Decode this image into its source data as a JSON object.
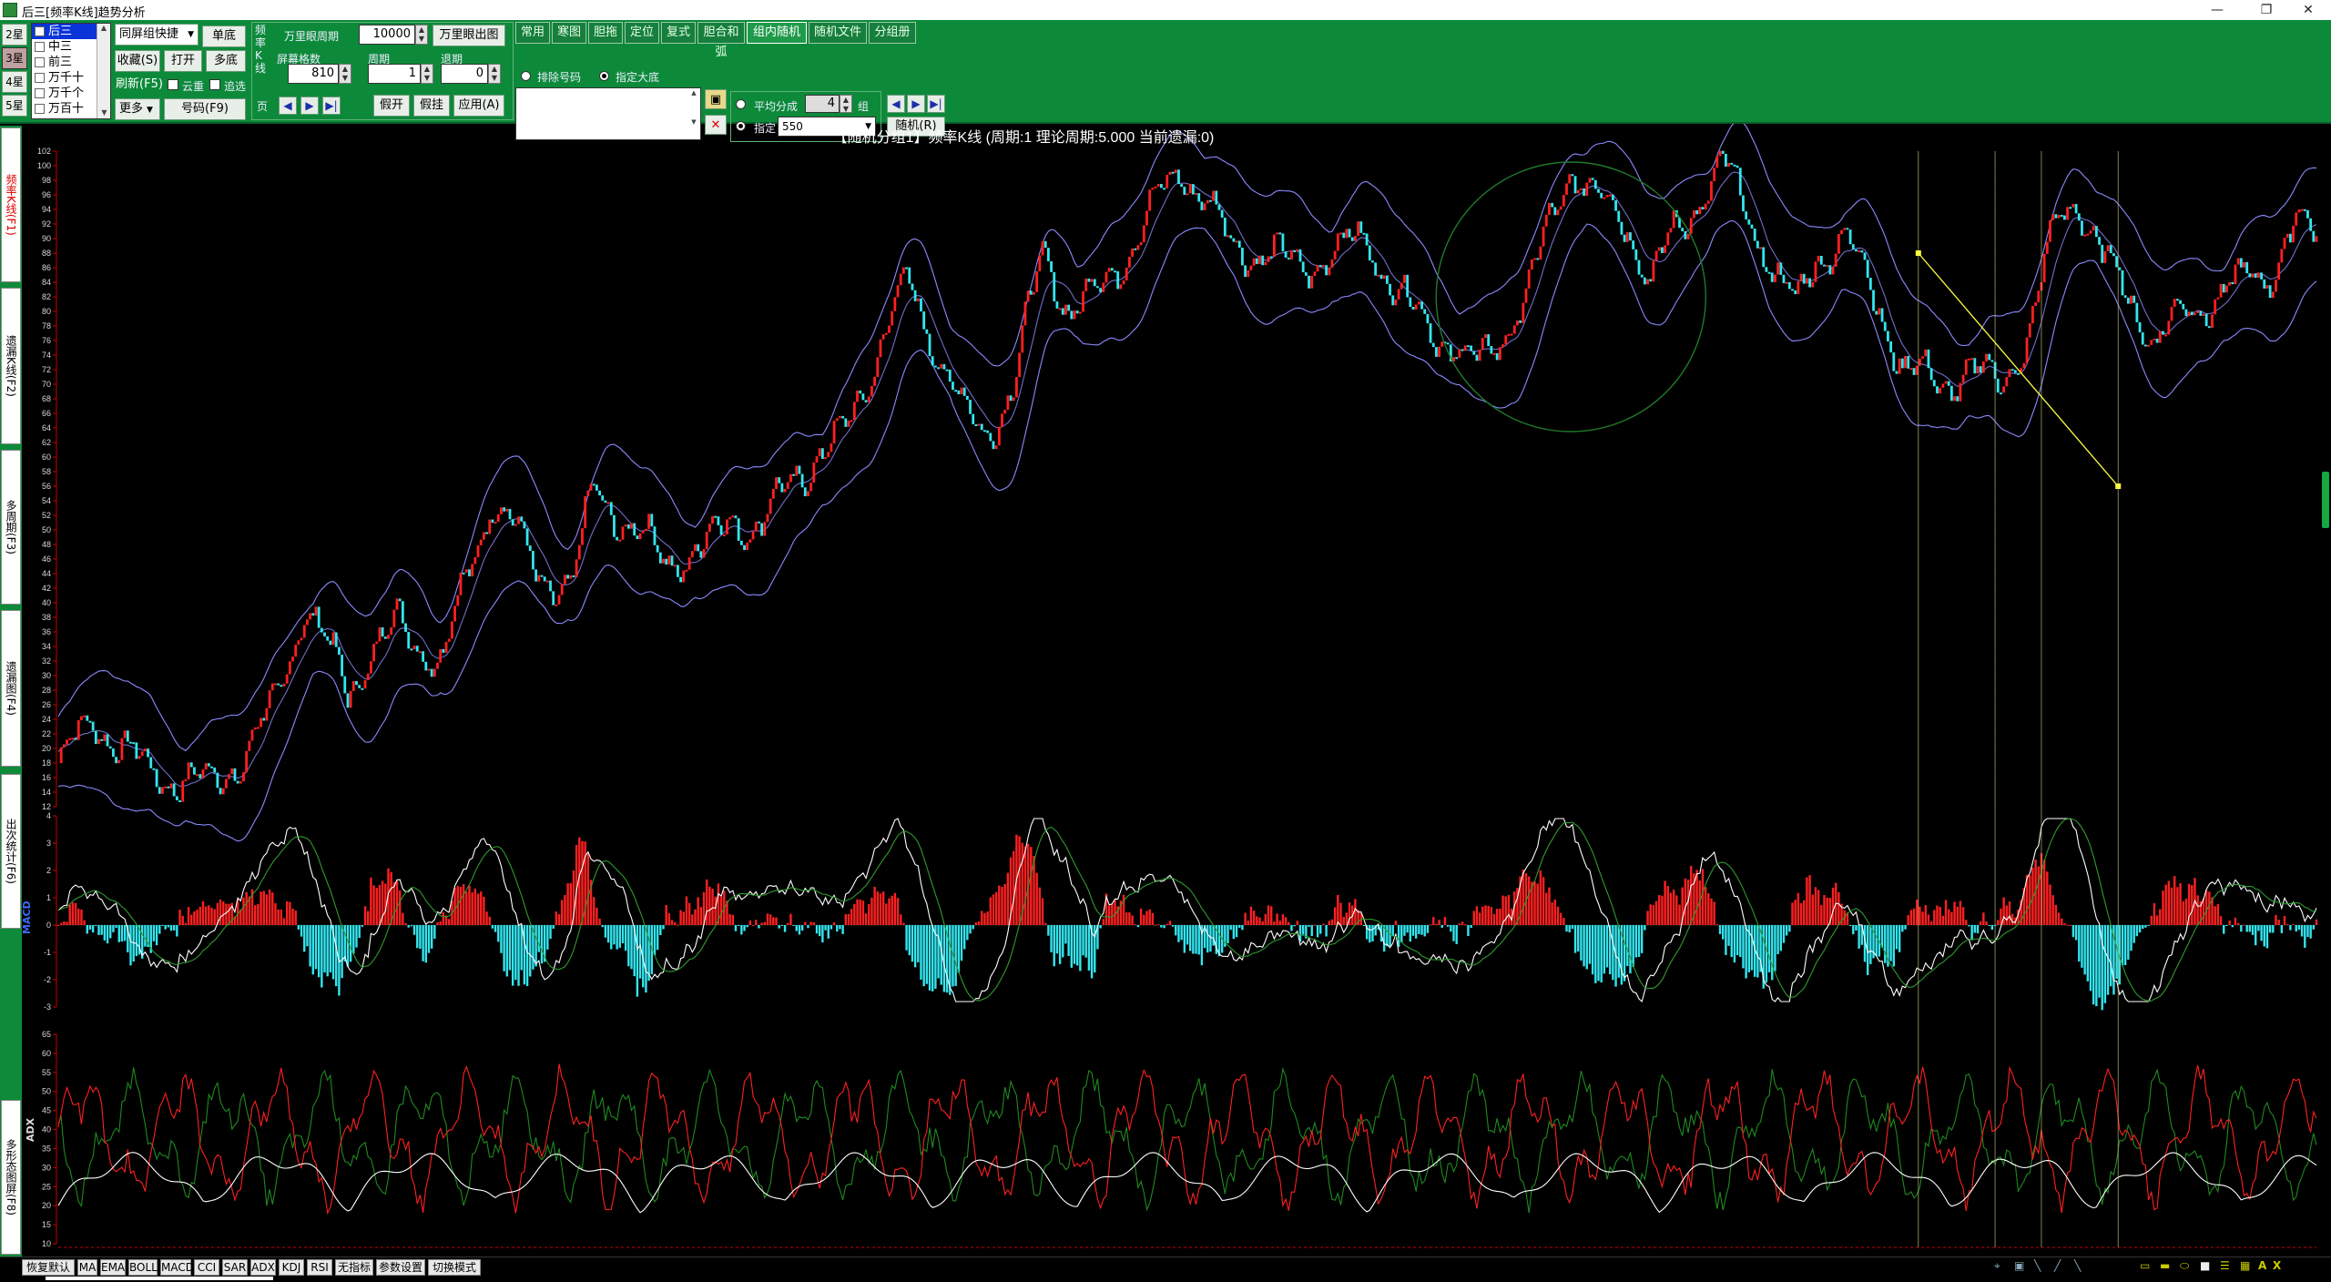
{
  "window": {
    "title": "后三[频率K线]趋势分析",
    "minimize": "—",
    "restore": "❐",
    "close": "✕"
  },
  "stars": [
    {
      "label": "2星",
      "active": false
    },
    {
      "label": "3星",
      "active": true
    },
    {
      "label": "4星",
      "active": false
    },
    {
      "label": "5星",
      "active": false
    }
  ],
  "positions": [
    {
      "label": "后三",
      "selected": true
    },
    {
      "label": "中三",
      "selected": false
    },
    {
      "label": "前三",
      "selected": false
    },
    {
      "label": "万千十",
      "selected": false
    },
    {
      "label": "万千个",
      "selected": false
    },
    {
      "label": "万百十",
      "selected": false
    }
  ],
  "group_control": {
    "dropdown": "同屏组快捷",
    "single": "单底",
    "collect": "收藏(S)",
    "open": "打开",
    "multi": "多底",
    "refresh": "刷新(F5)",
    "dedupe": "云重",
    "filter": "追选",
    "more": "更多",
    "number": "号码(F9)"
  },
  "freq_panel": {
    "vertical_label": "频率K线",
    "page_label": "页",
    "period_label": "万里眼周期",
    "period_value": "10000",
    "period_button": "万里眼出图",
    "screen_count_label": "屏幕格数",
    "screen_count_value": "810",
    "cycle_label": "周期",
    "cycle_value": "1",
    "retreat_label": "退期",
    "retreat_value": "0",
    "btn_open": "假开",
    "btn_hang": "假挂",
    "btn_apply": "应用(A)"
  },
  "tabs": [
    "常用",
    "寒图",
    "胆拖",
    "定位",
    "复式",
    "胆合和弧",
    "组内随机",
    "随机文件",
    "分组册"
  ],
  "active_tab": "组内随机",
  "random_panel": {
    "radio_exclude": "排除号码",
    "radio_fixed": "指定大底",
    "avg_label": "平均分成",
    "avg_value": "4",
    "avg_unit": "组",
    "specify_label": "指定",
    "specify_value": "550",
    "random_button": "随机(R)"
  },
  "side_tabs": [
    {
      "label": "频率K线(F1)",
      "active": true
    },
    {
      "label": "遗漏K线(F2)",
      "active": false
    },
    {
      "label": "多周期(F3)",
      "active": false
    },
    {
      "label": "遗漏图(F4)",
      "active": false
    },
    {
      "label": "出次统计(F6)",
      "active": false
    },
    {
      "label": "多形态图屏(F8)",
      "active": false
    }
  ],
  "chart_data": {
    "type": "line",
    "title": "【随机分组1】频率K线 (周期:1 理论周期:5.000 当前遗漏:0)",
    "panels": [
      {
        "name": "K线",
        "ylim": [
          12,
          102
        ],
        "yticks": [
          12,
          14,
          16,
          18,
          20,
          22,
          24,
          26,
          28,
          30,
          32,
          34,
          36,
          38,
          40,
          42,
          44,
          46,
          48,
          50,
          52,
          54,
          56,
          58,
          60,
          62,
          64,
          66,
          68,
          70,
          72,
          74,
          76,
          78,
          80,
          82,
          84,
          86,
          88,
          90,
          92,
          94,
          96,
          98,
          100,
          102
        ],
        "trend": [
          [
            0,
            18
          ],
          [
            25,
            24
          ],
          [
            60,
            17
          ],
          [
            100,
            15
          ],
          [
            125,
            18
          ],
          [
            150,
            26
          ],
          [
            170,
            40
          ],
          [
            185,
            34
          ],
          [
            200,
            28
          ],
          [
            215,
            33
          ],
          [
            235,
            37
          ],
          [
            265,
            32
          ],
          [
            285,
            45
          ],
          [
            300,
            55
          ],
          [
            315,
            50
          ],
          [
            330,
            44
          ],
          [
            355,
            42
          ],
          [
            370,
            56
          ],
          [
            395,
            50
          ],
          [
            420,
            46
          ],
          [
            445,
            47
          ],
          [
            465,
            52
          ],
          [
            485,
            50
          ],
          [
            510,
            58
          ],
          [
            540,
            62
          ],
          [
            565,
            74
          ],
          [
            585,
            84
          ],
          [
            605,
            76
          ],
          [
            625,
            66
          ],
          [
            640,
            63
          ],
          [
            660,
            70
          ],
          [
            680,
            88
          ],
          [
            700,
            80
          ],
          [
            720,
            83
          ],
          [
            750,
            92
          ],
          [
            775,
            100
          ],
          [
            790,
            96
          ],
          [
            810,
            89
          ],
          [
            835,
            88
          ],
          [
            855,
            86
          ],
          [
            880,
            88
          ],
          [
            905,
            90
          ],
          [
            920,
            84
          ],
          [
            935,
            80
          ],
          [
            960,
            76
          ],
          [
            980,
            72
          ],
          [
            1000,
            78
          ],
          [
            1015,
            82
          ],
          [
            1030,
            92
          ],
          [
            1045,
            100
          ],
          [
            1060,
            96
          ],
          [
            1085,
            92
          ],
          [
            1100,
            84
          ],
          [
            1115,
            90
          ],
          [
            1135,
            96
          ],
          [
            1150,
            100
          ],
          [
            1165,
            94
          ],
          [
            1185,
            86
          ],
          [
            1200,
            80
          ],
          [
            1215,
            88
          ],
          [
            1235,
            90
          ],
          [
            1255,
            82
          ],
          [
            1275,
            72
          ],
          [
            1300,
            70
          ],
          [
            1320,
            72
          ],
          [
            1340,
            70
          ],
          [
            1360,
            76
          ],
          [
            1380,
            92
          ],
          [
            1395,
            96
          ],
          [
            1410,
            88
          ],
          [
            1430,
            82
          ],
          [
            1450,
            76
          ],
          [
            1470,
            80
          ],
          [
            1490,
            82
          ],
          [
            1510,
            84
          ],
          [
            1530,
            86
          ],
          [
            1545,
            92
          ],
          [
            1560,
            90
          ]
        ],
        "band_width": 8
      },
      {
        "name": "MACD",
        "ylim": [
          -3,
          4
        ],
        "yticks": [
          -3,
          -2,
          -1,
          0,
          1,
          2,
          3,
          4
        ],
        "label": "MACD"
      },
      {
        "name": "ADX",
        "ylim": [
          10,
          65
        ],
        "yticks": [
          10,
          15,
          20,
          25,
          30,
          35,
          40,
          45,
          50,
          55,
          60,
          65
        ],
        "label": "ADX"
      }
    ],
    "annotations": {
      "vertical_lines_x": [
        1285,
        1338,
        1370,
        1423
      ],
      "circle_center": [
        1045,
        82
      ],
      "trendline": [
        [
          1285,
          88
        ],
        [
          1423,
          56
        ]
      ]
    },
    "colors": {
      "up": "#ff2020",
      "down": "#33e6f0",
      "band": "#8a8aff",
      "grid": "#3a0000",
      "axis": "#cc0000",
      "dif": "#ffffff",
      "dea": "#2e9a2e",
      "pdi": "#ff2020",
      "mdi": "#1f8a1f",
      "adx": "#ffffff",
      "annotation": "#c8c880",
      "trendline": "#ffff40",
      "circle": "#1f7a2a"
    }
  },
  "indicator_buttons": [
    "恢复默认",
    "MA",
    "EMA",
    "BOLL",
    "MACD",
    "CCI",
    "SAR",
    "ADX",
    "KDJ",
    "RSI",
    "无指标",
    "参数设置",
    "切换模式"
  ]
}
